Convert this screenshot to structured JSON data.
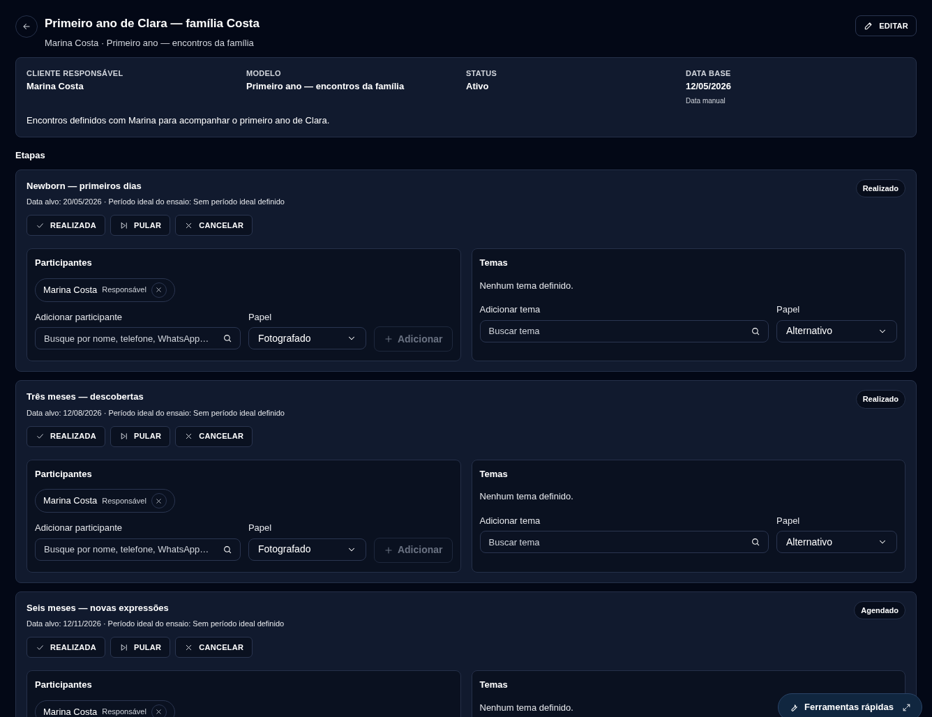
{
  "header": {
    "title": "Primeiro ano de Clara — família Costa",
    "subtitle": "Marina Costa · Primeiro ano — encontros da família",
    "edit_button": "EDITAR"
  },
  "summary": {
    "fields": [
      {
        "label": "CLIENTE RESPONSÁVEL",
        "value": "Marina Costa"
      },
      {
        "label": "MODELO",
        "value": "Primeiro ano — encontros da família"
      },
      {
        "label": "STATUS",
        "value": "Ativo"
      },
      {
        "label": "DATA BASE",
        "value": "12/05/2026",
        "note": "Data manual"
      }
    ],
    "description": "Encontros definidos com Marina para acompanhar o primeiro ano de Clara."
  },
  "section_title": "Etapas",
  "stages": [
    {
      "title": "Newborn — primeiros dias",
      "meta": "Data alvo: 20/05/2026 · Período ideal do ensaio: Sem período ideal definido",
      "status": "Realizado",
      "actions": [
        {
          "kind": "done",
          "label": "REALIZADA"
        },
        {
          "kind": "skip",
          "label": "PULAR"
        },
        {
          "kind": "cancel",
          "label": "CANCELAR"
        }
      ],
      "participants": {
        "title": "Participantes",
        "chips": [
          {
            "name": "Marina Costa",
            "role": "Responsável"
          }
        ],
        "add_label": "Adicionar participante",
        "placeholder": "Busque por nome, telefone, WhatsApp…",
        "role_label": "Papel",
        "role_value": "Fotografado",
        "add_button": {
          "label": "Adicionar",
          "disabled": true
        }
      },
      "themes": {
        "title": "Temas",
        "empty": "Nenhum tema definido.",
        "add_label": "Adicionar tema",
        "placeholder": "Buscar tema",
        "role_label": "Papel",
        "role_value": "Alternativo"
      }
    },
    {
      "title": "Três meses — descobertas",
      "meta": "Data alvo: 12/08/2026 · Período ideal do ensaio: Sem período ideal definido",
      "status": "Realizado",
      "actions": [
        {
          "kind": "done",
          "label": "REALIZADA"
        },
        {
          "kind": "skip",
          "label": "PULAR"
        },
        {
          "kind": "cancel",
          "label": "CANCELAR"
        }
      ],
      "participants": {
        "title": "Participantes",
        "chips": [
          {
            "name": "Marina Costa",
            "role": "Responsável"
          }
        ],
        "add_label": "Adicionar participante",
        "placeholder": "Busque por nome, telefone, WhatsApp…",
        "role_label": "Papel",
        "role_value": "Fotografado",
        "add_button": {
          "label": "Adicionar",
          "disabled": true
        }
      },
      "themes": {
        "title": "Temas",
        "empty": "Nenhum tema definido.",
        "add_label": "Adicionar tema",
        "placeholder": "Buscar tema",
        "role_label": "Papel",
        "role_value": "Alternativo"
      }
    },
    {
      "title": "Seis meses — novas expressões",
      "meta": "Data alvo: 12/11/2026 · Período ideal do ensaio: Sem período ideal definido",
      "status": "Agendado",
      "actions": [
        {
          "kind": "done",
          "label": "REALIZADA"
        },
        {
          "kind": "skip",
          "label": "PULAR"
        },
        {
          "kind": "cancel",
          "label": "CANCELAR"
        }
      ],
      "participants": {
        "title": "Participantes",
        "chips": [
          {
            "name": "Marina Costa",
            "role": "Responsável"
          }
        ]
      },
      "themes": {
        "title": "Temas",
        "empty": "Nenhum tema definido."
      }
    }
  ],
  "quick_tools": "Ferramentas rápidas"
}
